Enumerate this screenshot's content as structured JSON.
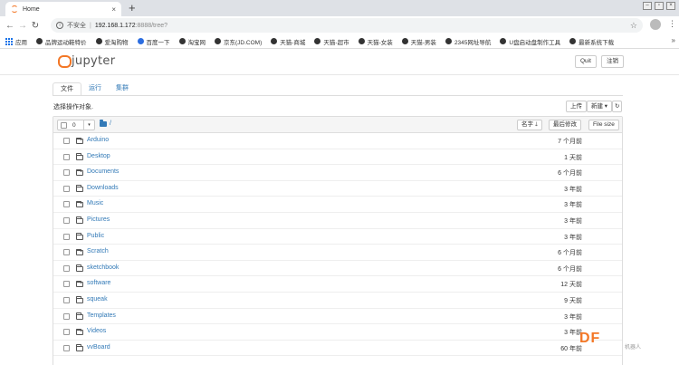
{
  "browser": {
    "tab_title": "Home",
    "tab_close": "×",
    "new_tab": "+",
    "insecure_label": "不安全",
    "separator": "|",
    "url_host": "192.168.1.172",
    "url_path": ":8888/tree?",
    "bookmarks": [
      {
        "label": "应用",
        "icon": "apps-grid-icon"
      },
      {
        "label": "品牌运动鞋特价",
        "icon": "globe-icon"
      },
      {
        "label": "爱淘购物",
        "icon": "globe-icon"
      },
      {
        "label": "百度一下",
        "icon": "baidu-paw-icon"
      },
      {
        "label": "淘宝网",
        "icon": "globe-icon"
      },
      {
        "label": "京东(JD.COM)",
        "icon": "globe-icon"
      },
      {
        "label": "天猫-商城",
        "icon": "globe-icon"
      },
      {
        "label": "天猫-超市",
        "icon": "globe-icon"
      },
      {
        "label": "天猫-女装",
        "icon": "globe-icon"
      },
      {
        "label": "天猫-男装",
        "icon": "globe-icon"
      },
      {
        "label": "2345网址导航",
        "icon": "globe-icon"
      },
      {
        "label": "U盘启动盘制作工具",
        "icon": "globe-icon"
      },
      {
        "label": "最新系统下载",
        "icon": "globe-icon"
      }
    ]
  },
  "jupyter": {
    "logo_text": "jupyter",
    "quit_label": "Quit",
    "logout_label": "注销",
    "tabs": [
      {
        "label": "文件",
        "active": true
      },
      {
        "label": "运行",
        "active": false
      },
      {
        "label": "集群",
        "active": false
      }
    ],
    "toolbar": {
      "select_label": "选择操作对象.",
      "upload_label": "上传",
      "new_label": "新建 ▾",
      "refresh_icon": "refresh-icon"
    },
    "list_header": {
      "selected_count": "0",
      "caret": "▾",
      "breadcrumb_sep": "/",
      "sort_name": "名字 🡓",
      "sort_modified": "最后修改",
      "sort_size": "File size"
    },
    "files": [
      {
        "name": "Arduino",
        "modified": "7 个月前"
      },
      {
        "name": "Desktop",
        "modified": "1 天前"
      },
      {
        "name": "Documents",
        "modified": "6 个月前"
      },
      {
        "name": "Downloads",
        "modified": "3 年前"
      },
      {
        "name": "Music",
        "modified": "3 年前"
      },
      {
        "name": "Pictures",
        "modified": "3 年前"
      },
      {
        "name": "Public",
        "modified": "3 年前"
      },
      {
        "name": "Scratch",
        "modified": "6 个月前"
      },
      {
        "name": "sketchbook",
        "modified": "6 个月前"
      },
      {
        "name": "software",
        "modified": "12 天前"
      },
      {
        "name": "squeak",
        "modified": "9 天前"
      },
      {
        "name": "Templates",
        "modified": "3 年前"
      },
      {
        "name": "Videos",
        "modified": "3 年前"
      },
      {
        "name": "vvBoard",
        "modified": "60 年前"
      }
    ]
  },
  "watermark": {
    "text": "DF",
    "sub": "机器人"
  },
  "colors": {
    "jupyter_orange": "#f37726",
    "link_blue": "#337ab7"
  }
}
